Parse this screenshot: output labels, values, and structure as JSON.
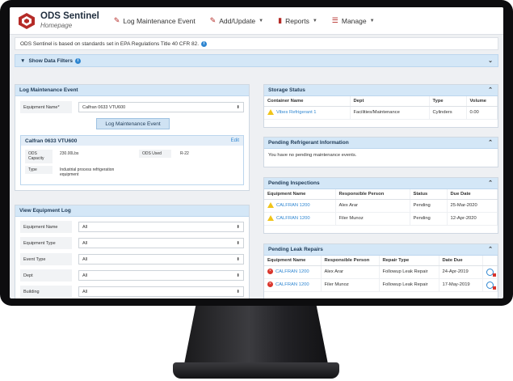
{
  "app": {
    "title": "ODS Sentinel",
    "subtitle": "Homepage"
  },
  "nav": [
    {
      "label": "Log Maintenance Event",
      "icon": "edit-icon",
      "caret": false
    },
    {
      "label": "Add/Update",
      "icon": "edit-icon",
      "caret": true
    },
    {
      "label": "Reports",
      "icon": "bookmark-icon",
      "caret": true
    },
    {
      "label": "Manage",
      "icon": "sliders-icon",
      "caret": true
    }
  ],
  "notice": "ODS Sentinel is based on standards set in EPA Regulations Title 40 CFR 82.",
  "filters": {
    "label": "Show Data Filters"
  },
  "log_event": {
    "title": "Log Maintenance Event",
    "equipment_label": "Equipment Name*",
    "equipment_value": "Calfran 0633 VTU600",
    "button": "Log Maintenance Event",
    "card_title": "Calfran 0633 VTU600",
    "edit": "Edit",
    "ods_capacity_label": "ODS Capacity",
    "ods_capacity_value": "230.00Lbs",
    "ods_used_label": "ODS Used",
    "ods_used_value": "R-22",
    "type_label": "Type",
    "type_value": "Industrial process refrigeration equipment"
  },
  "view_log": {
    "title": "View Equipment Log",
    "filters": [
      {
        "label": "Equipment Name",
        "value": "All"
      },
      {
        "label": "Equipment Type",
        "value": "All"
      },
      {
        "label": "Event Type",
        "value": "All"
      },
      {
        "label": "Dept",
        "value": "All"
      },
      {
        "label": "Building",
        "value": "All"
      }
    ]
  },
  "storage": {
    "title": "Storage Status",
    "columns": [
      "Container Name",
      "Dept",
      "Type",
      "Volume"
    ],
    "rows": [
      {
        "name": "Vibes Refrigerant 1",
        "dept": "Facilities/Maintenance",
        "type": "Cylinders",
        "volume": "0.00"
      }
    ]
  },
  "pending_refrigerant": {
    "title": "Pending Refrigerant Information",
    "message": "You have no pending maintenance events."
  },
  "inspections": {
    "title": "Pending Inspections",
    "columns": [
      "Equipment Name",
      "Responsible Person",
      "Status",
      "Due Date"
    ],
    "rows": [
      {
        "name": "CALFRAN 1200",
        "person": "Alex Arar",
        "status": "Pending",
        "due": "25-Mar-2020"
      },
      {
        "name": "CALFRAN 1200",
        "person": "Filer Munoz",
        "status": "Pending",
        "due": "12-Apr-2020"
      }
    ]
  },
  "leak_repairs": {
    "title": "Pending Leak Repairs",
    "columns": [
      "Equipment Name",
      "Responsible Person",
      "Repair Type",
      "Date Due"
    ],
    "rows": [
      {
        "name": "CALFRAN 1200",
        "person": "Alex Arar",
        "type": "Followup Leak Repair",
        "due": "24-Apr-2019"
      },
      {
        "name": "CALFRAN 1200",
        "person": "Filer Munoz",
        "type": "Followup Leak Repair",
        "due": "17-May-2019"
      }
    ]
  },
  "colors": {
    "brand": "#b52b27",
    "header_bg": "#d4e7f7",
    "link": "#2f86d1",
    "warning": "#f0c419",
    "error": "#d9342b"
  }
}
